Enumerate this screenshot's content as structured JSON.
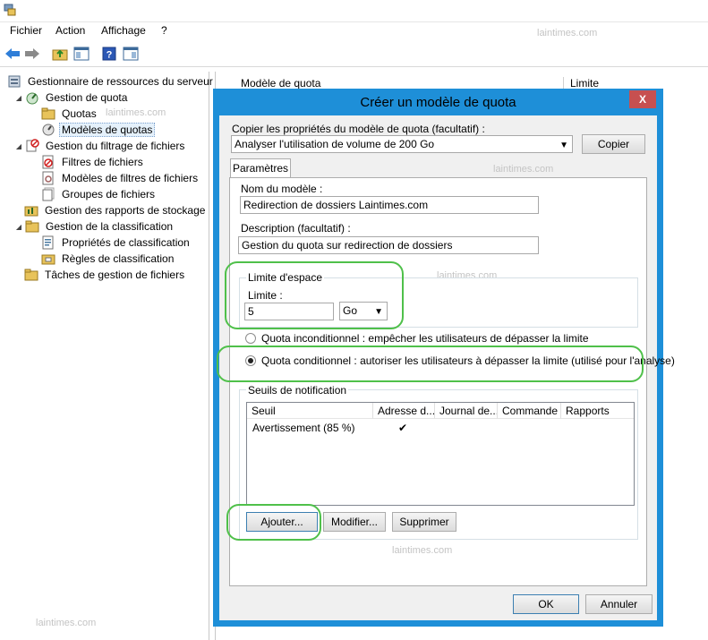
{
  "menu": [
    "Fichier",
    "Action",
    "Affichage",
    "?"
  ],
  "watermark": "laintimes.com",
  "tree": {
    "root": "Gestionnaire de ressources du serveur",
    "items": [
      {
        "label": "Gestion de quota"
      },
      {
        "label": "Quotas"
      },
      {
        "label": "Modèles de quotas"
      },
      {
        "label": "Gestion du filtrage de fichiers"
      },
      {
        "label": "Filtres de fichiers"
      },
      {
        "label": "Modèles de filtres de fichiers"
      },
      {
        "label": "Groupes de fichiers"
      },
      {
        "label": "Gestion des rapports de stockage"
      },
      {
        "label": "Gestion de la classification"
      },
      {
        "label": "Propriétés de classification"
      },
      {
        "label": "Règles de classification"
      },
      {
        "label": "Tâches de gestion de fichiers"
      }
    ]
  },
  "listview": {
    "columns": [
      "Modèle de quota",
      "Limite"
    ]
  },
  "dialog": {
    "title": "Créer un modèle de quota",
    "close": "X",
    "copy_label": "Copier les propriétés du modèle de quota (facultatif) :",
    "copy_value": "Analyser l'utilisation de volume de 200 Go",
    "copy_button": "Copier",
    "tab": "Paramètres",
    "name_label": "Nom du modèle :",
    "name_value": "Redirection de dossiers Laintimes.com",
    "desc_label": "Description (facultatif) :",
    "desc_value": "Gestion du quota sur redirection de dossiers",
    "space_group": "Limite d'espace",
    "limit_label": "Limite :",
    "limit_value": "5",
    "unit_value": "Go",
    "radio_hard": "Quota inconditionnel : empêcher les utilisateurs de dépasser la limite",
    "radio_soft": "Quota conditionnel : autoriser les utilisateurs à dépasser la limite (utilisé pour l'analyse)",
    "notif_group": "Seuils de notification",
    "grid_columns": [
      "Seuil",
      "Adresse d...",
      "Journal de...",
      "Commande",
      "Rapports"
    ],
    "grid_rows": [
      {
        "seuil": "Avertissement (85 %)",
        "email": "✔"
      }
    ],
    "add_button": "Ajouter...",
    "edit_button": "Modifier...",
    "delete_button": "Supprimer",
    "ok_button": "OK",
    "cancel_button": "Annuler"
  }
}
